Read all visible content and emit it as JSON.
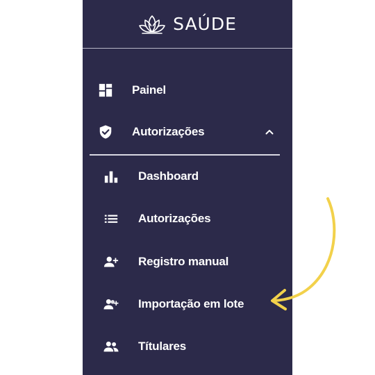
{
  "brand": {
    "name": "SAÚDE",
    "logo_icon": "lotus-logo-icon"
  },
  "colors": {
    "sidebar_bg": "#2c2a4a",
    "text": "#ffffff",
    "annotation_arrow": "#f2d14b"
  },
  "menu": {
    "items": [
      {
        "label": "Painel",
        "icon": "dashboard-grid-icon"
      },
      {
        "label": "Autorizações",
        "icon": "shield-check-icon",
        "expanded": true,
        "chevron_icon": "chevron-up-icon"
      }
    ],
    "subitems": [
      {
        "label": "Dashboard",
        "icon": "bar-chart-icon"
      },
      {
        "label": "Autorizações",
        "icon": "list-icon"
      },
      {
        "label": "Registro manual",
        "icon": "person-add-icon"
      },
      {
        "label": "Importação em lote",
        "icon": "group-add-icon"
      },
      {
        "label": "Títulares",
        "icon": "people-icon"
      }
    ]
  }
}
